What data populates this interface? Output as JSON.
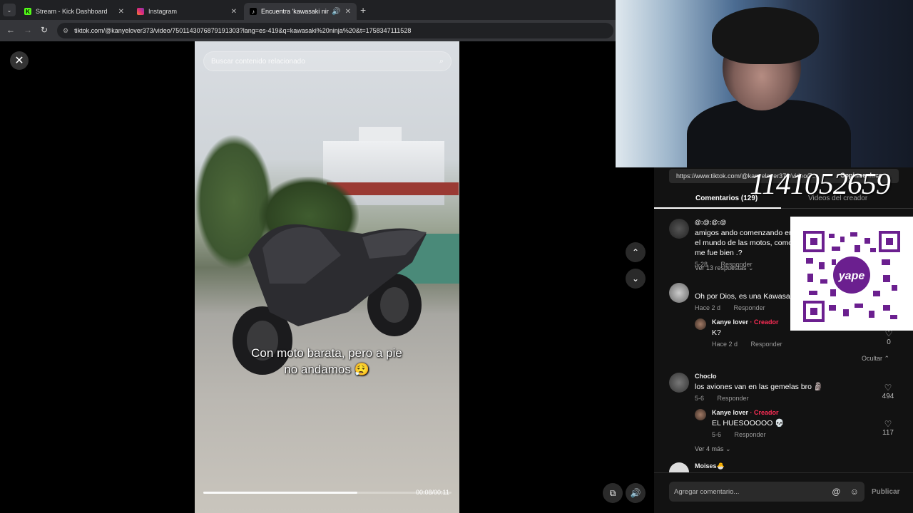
{
  "browser": {
    "tabs": [
      {
        "label": "Stream - Kick Dashboard",
        "icon": "kick-icon",
        "active": false
      },
      {
        "label": "Instagram",
        "icon": "instagram-icon",
        "active": false
      },
      {
        "label": "Encuentra 'kawasaki ninja'",
        "icon": "tiktok-icon",
        "active": true
      }
    ],
    "new_tab": "+",
    "url": "tiktok.com/@kanyelover373/video/7501143076879191303?lang=es-419&q=kawasaki%20ninja%20&t=1758347111528"
  },
  "viewer": {
    "search_placeholder": "Buscar contenido relacionado",
    "caption_line1": "Con moto barata, pero a pie",
    "caption_line2": "no andamos 😮‍💨",
    "timecode": "00:08/00:11",
    "progress": 0.62
  },
  "overlay": {
    "number": "1141052659"
  },
  "panel": {
    "link": "https://www.tiktok.com/@kanyelover373/video/7...",
    "copy_link": "Copiar enlace",
    "tab_comments": "Comentarios (129)",
    "tab_videos": "Videos del creador",
    "comments": [
      {
        "user": "@:@:@:@",
        "text": "amigos ando comenzando en el mundo de las motos, como me fue bien .?",
        "date": "5-28",
        "reply": "Responder",
        "more": "Ver 13 respuestas ⌄"
      },
      {
        "user": "",
        "text": "Oh por Dios, es una Kawasaki",
        "date": "Hace 2 d",
        "reply": "Responder"
      },
      {
        "user": "Kanye lover",
        "creator": "· Creador",
        "text": "K?",
        "date": "Hace 2 d",
        "reply": "Responder",
        "likes": "0",
        "hide": "Ocultar ⌃"
      },
      {
        "user": "Choclo",
        "text": "los aviones van en las gemelas bro 🗿",
        "date": "5-6",
        "reply": "Responder",
        "likes": "494"
      },
      {
        "user": "Kanye lover",
        "creator": "· Creador",
        "text": "EL HUESOOOOO 💀",
        "date": "5-6",
        "reply": "Responder",
        "likes": "117",
        "more": "Ver 4 más ⌄"
      },
      {
        "user": "Moises🐣"
      }
    ],
    "input_placeholder": "Agregar comentario...",
    "publish": "Publicar"
  }
}
